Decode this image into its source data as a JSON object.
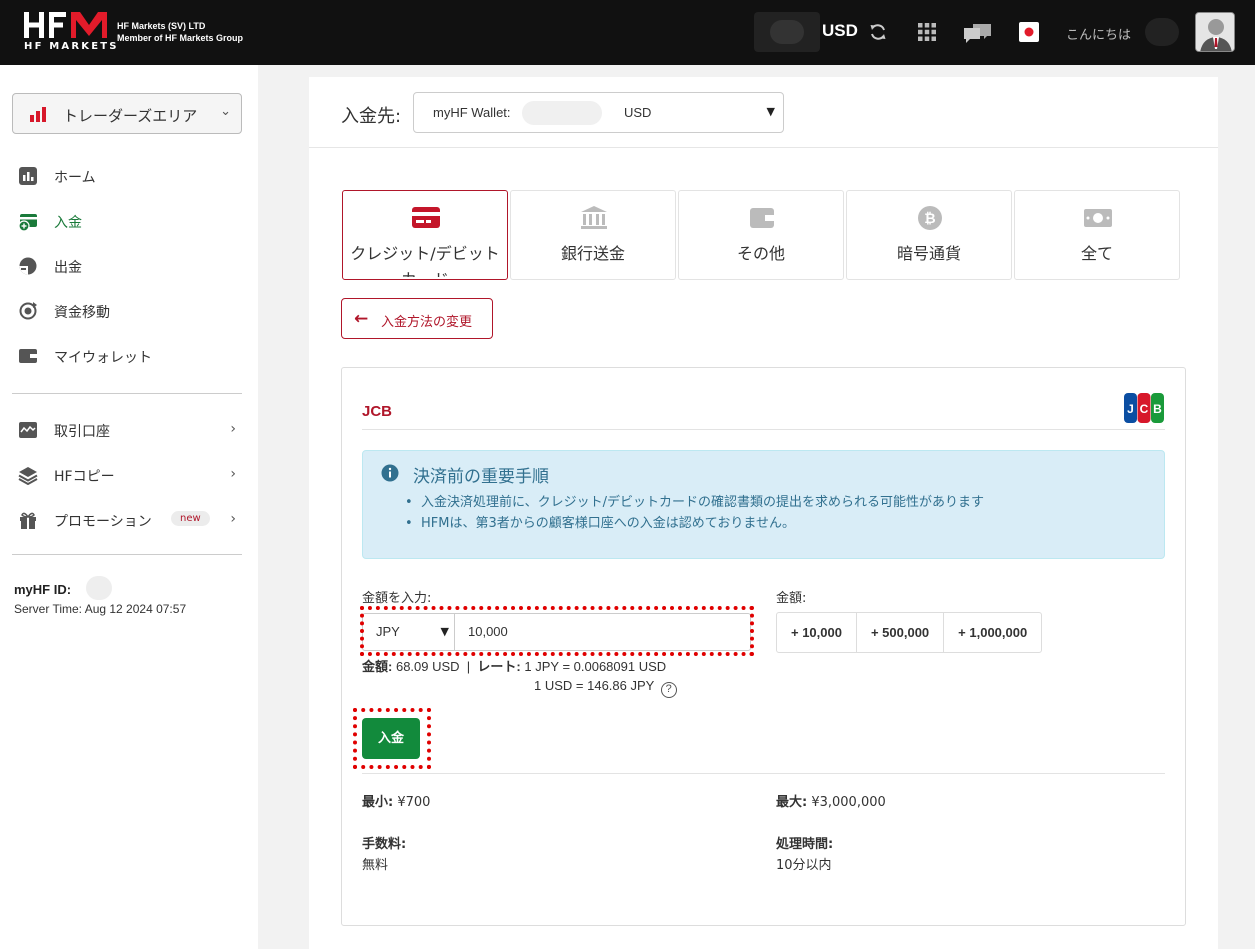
{
  "header": {
    "logo_text": "HFM",
    "logo_sub": "HF MARKETS",
    "company_line1": "HF Markets (SV) LTD",
    "company_line2": "Member of HF Markets Group",
    "currency": "USD",
    "greeting": "こんにちは",
    "icons": [
      "refresh-icon",
      "apps-grid-icon",
      "chat-icon",
      "japan-flag-icon",
      "avatar"
    ]
  },
  "sidebar": {
    "area_select": "トレーダーズエリア",
    "items": [
      {
        "label": "ホーム",
        "icon": "chart-icon"
      },
      {
        "label": "入金",
        "icon": "deposit-icon",
        "active": true
      },
      {
        "label": "出金",
        "icon": "withdraw-icon"
      },
      {
        "label": "資金移動",
        "icon": "transfer-icon"
      },
      {
        "label": "マイウォレット",
        "icon": "wallet-icon"
      }
    ],
    "items2": [
      {
        "label": "取引口座",
        "icon": "accounts-icon"
      },
      {
        "label": "HFコピー",
        "icon": "layers-icon"
      },
      {
        "label": "プロモーション",
        "icon": "gift-icon",
        "badge": "new"
      }
    ],
    "myhf_id_label": "myHF ID:",
    "server_time": "Server Time: Aug 12 2024 07:57"
  },
  "main": {
    "destination_label": "入金先:",
    "destination_wallet": "myHF Wallet:",
    "destination_currency": "USD",
    "tabs": [
      {
        "label": "クレジット/デビットカード",
        "icon": "credit-card-icon",
        "active": true
      },
      {
        "label": "銀行送金",
        "icon": "bank-icon"
      },
      {
        "label": "その他",
        "icon": "wallet-icon"
      },
      {
        "label": "暗号通貨",
        "icon": "bitcoin-icon"
      },
      {
        "label": "全て",
        "icon": "money-icon"
      }
    ],
    "change_method": "入金方法の変更",
    "card": {
      "title": "JCB",
      "alert_title": "決済前の重要手順",
      "alert_items": [
        "入金決済処理前に、クレジット/デビットカードの確認書類の提出を求められる可能性があります",
        "HFMは、第3者からの顧客様口座への入金は認めておりません。"
      ],
      "amount_input_label": "金額を入力:",
      "amount_label": "金額:",
      "currency": "JPY",
      "amount_value": "10,000",
      "quick_amounts": [
        "+ 10,000",
        "+ 500,000",
        "+ 1,000,000"
      ],
      "converted_label": "金額:",
      "converted_value": "68.09 USD",
      "rate_label": "レート:",
      "rate_line1": "1 JPY = 0.0068091 USD",
      "rate_line2": "1 USD = 146.86 JPY",
      "deposit_button": "入金",
      "min_label": "最小:",
      "min_value": "¥700",
      "max_label": "最大:",
      "max_value": "¥3,000,000",
      "fee_label": "手数料:",
      "fee_value": "無料",
      "time_label": "処理時間:",
      "time_value": "10分以内"
    }
  },
  "colors": {
    "brand_red": "#b0162a",
    "active_green": "#1a7a3a",
    "button_green": "#128a3c",
    "alert_bg": "#d9edf7",
    "highlight_dotted": "#e00000"
  }
}
